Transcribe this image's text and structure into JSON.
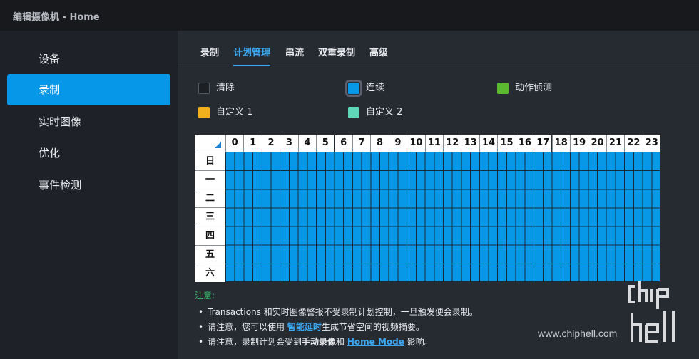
{
  "window": {
    "title": "编辑摄像机 - Home"
  },
  "sidebar": {
    "items": [
      {
        "label": "设备",
        "active": false
      },
      {
        "label": "录制",
        "active": true
      },
      {
        "label": "实时图像",
        "active": false
      },
      {
        "label": "优化",
        "active": false
      },
      {
        "label": "事件检测",
        "active": false
      }
    ]
  },
  "tabs": [
    {
      "label": "录制",
      "active": false
    },
    {
      "label": "计划管理",
      "active": true
    },
    {
      "label": "串流",
      "active": false
    },
    {
      "label": "双重录制",
      "active": false
    },
    {
      "label": "高级",
      "active": false
    }
  ],
  "legend": [
    {
      "label": "清除",
      "color": "#1c1f24",
      "selected": false
    },
    {
      "label": "连续",
      "color": "#0898e8",
      "selected": true
    },
    {
      "label": "动作侦测",
      "color": "#5cb82e",
      "selected": false
    },
    {
      "label": "自定义 1",
      "color": "#f2b01e",
      "selected": false
    },
    {
      "label": "自定义 2",
      "color": "#5fd6b8",
      "selected": false
    }
  ],
  "schedule": {
    "hours": [
      "0",
      "1",
      "2",
      "3",
      "4",
      "5",
      "6",
      "7",
      "8",
      "9",
      "10",
      "11",
      "12",
      "13",
      "14",
      "15",
      "16",
      "17",
      "18",
      "19",
      "20",
      "21",
      "22",
      "23"
    ],
    "days": [
      "日",
      "一",
      "二",
      "三",
      "四",
      "五",
      "六"
    ],
    "fill_mode": "连续"
  },
  "notes": {
    "heading": "注意:",
    "line1": "Transactions 和实时图像警报不受录制计划控制，一旦触发便会录制。",
    "line2_pre": "请注意，您可以使用 ",
    "line2_link": "智能延时",
    "line2_post": "生成节省空间的视频摘要。",
    "line3_pre": "请注意，录制计划会受到",
    "line3_bold": "手动录像",
    "line3_mid": "和 ",
    "line3_link": "Home Mode",
    "line3_post": " 影响。"
  },
  "watermark": {
    "text": "www.chiphell.com"
  }
}
